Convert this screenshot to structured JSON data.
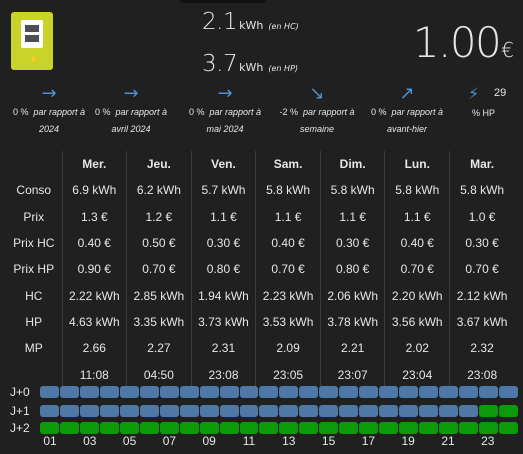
{
  "summary": {
    "hc_value": "2.1",
    "hc_unit": "kWh",
    "hc_suffix": "(en HC)",
    "hp_value": "3.7",
    "hp_unit": "kWh",
    "hp_suffix": "(en HP)",
    "cost_value": "1.00",
    "cost_currency": "€"
  },
  "comparisons": [
    {
      "pct": "0 %",
      "label": "par rapport à",
      "label2": "2024",
      "arrow": "right-arrow-icon",
      "glyph": "→"
    },
    {
      "pct": "0 %",
      "label": "par rapport à",
      "label2": "avril 2024",
      "arrow": "right-arrow-icon",
      "glyph": "→"
    },
    {
      "pct": "0 %",
      "label": "par rapport à",
      "label2": "mai 2024",
      "arrow": "right-arrow-icon",
      "glyph": "→"
    },
    {
      "pct": "-2 %",
      "label": "par rapport à",
      "label2": "semaine",
      "arrow": "down-right-arrow-icon",
      "glyph": "↘"
    },
    {
      "pct": "0 %",
      "label": "par rapport à",
      "label2": "avant-hier",
      "arrow": "up-right-arrow-icon",
      "glyph": "↗"
    }
  ],
  "hp_ratio": {
    "value": "29",
    "label": "% HP"
  },
  "table": {
    "days": [
      "Mer.",
      "Jeu.",
      "Ven.",
      "Sam.",
      "Dim.",
      "Lun.",
      "Mar."
    ],
    "rows": [
      {
        "label": "Conso",
        "values": [
          "6.9 kWh",
          "6.2 kWh",
          "5.7 kWh",
          "5.8 kWh",
          "5.8 kWh",
          "5.8 kWh",
          "5.8 kWh"
        ]
      },
      {
        "label": "Prix",
        "values": [
          "1.3 €",
          "1.2 €",
          "1.1 €",
          "1.1 €",
          "1.1 €",
          "1.1 €",
          "1.0 €"
        ]
      },
      {
        "label": "Prix HC",
        "values": [
          "0.40 €",
          "0.50 €",
          "0.30 €",
          "0.40 €",
          "0.30 €",
          "0.40 €",
          "0.30 €"
        ]
      },
      {
        "label": "Prix HP",
        "values": [
          "0.90 €",
          "0.70 €",
          "0.80 €",
          "0.70 €",
          "0.80 €",
          "0.70 €",
          "0.70 €"
        ]
      },
      {
        "label": "HC",
        "values": [
          "2.22 kWh",
          "2.85 kWh",
          "1.94 kWh",
          "2.23 kWh",
          "2.06 kWh",
          "2.20 kWh",
          "2.12 kWh"
        ]
      },
      {
        "label": "HP",
        "values": [
          "4.63 kWh",
          "3.35 kWh",
          "3.73 kWh",
          "3.53 kWh",
          "3.78 kWh",
          "3.56 kWh",
          "3.67 kWh"
        ]
      },
      {
        "label": "MP",
        "values": [
          "2.66",
          "2.27",
          "2.31",
          "2.09",
          "2.21",
          "2.02",
          "2.32"
        ]
      },
      {
        "label": "",
        "values": [
          "11:08",
          "04:50",
          "23:08",
          "23:05",
          "23:07",
          "23:04",
          "23:08"
        ]
      }
    ]
  },
  "timeline": {
    "rows": [
      {
        "label": "J+0",
        "hp_from": 24
      },
      {
        "label": "J+1",
        "hp_from": 22
      },
      {
        "label": "J+2",
        "hp_from": 0
      }
    ],
    "segments": 24,
    "hour_labels": [
      "01",
      "03",
      "05",
      "07",
      "09",
      "11",
      "13",
      "15",
      "17",
      "19",
      "21",
      "23"
    ]
  },
  "colors": {
    "accent": "#4f8fd0",
    "hc_bar": "#4e79a7",
    "hp_bar": "#0a9a0a",
    "icon_bg": "#c8d42a",
    "background": "#202020"
  }
}
